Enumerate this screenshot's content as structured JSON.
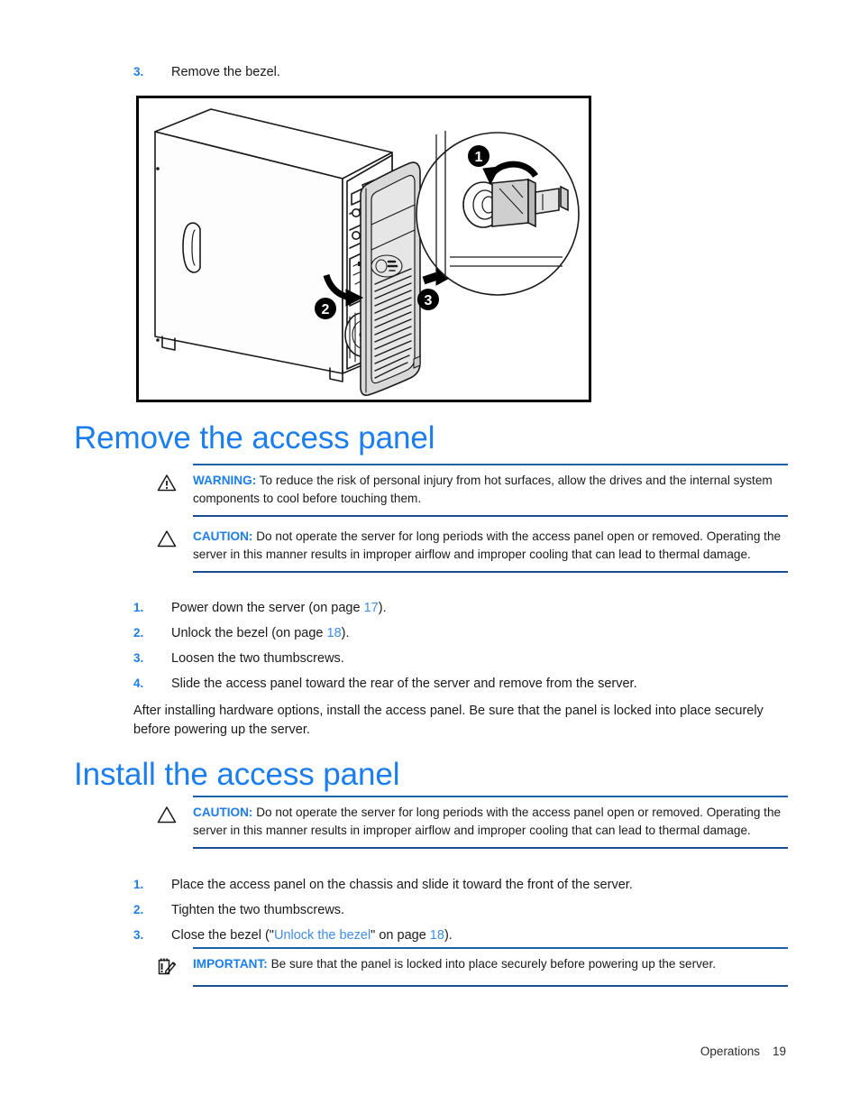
{
  "top_step": {
    "number": "3.",
    "text": "Remove the bezel."
  },
  "figure": {
    "alt": "Tower server with bezel removal steps",
    "callouts": [
      "1",
      "2",
      "3"
    ]
  },
  "sections": [
    {
      "heading": "Remove the access panel"
    },
    {
      "heading": "Install the access panel"
    }
  ],
  "notices": {
    "warning": {
      "icon": "warning-triangle-icon",
      "label": "WARNING:",
      "text": "To reduce the risk of personal injury from hot surfaces, allow the drives and the internal system components to cool before touching them."
    },
    "caution_remove": {
      "icon": "caution-triangle-icon",
      "label": "CAUTION:",
      "text": "Do not operate the server for long periods with the access panel open or removed. Operating the server in this manner results in improper airflow and improper cooling that can lead to thermal damage."
    },
    "caution_install": {
      "icon": "caution-triangle-icon",
      "label": "CAUTION:",
      "text": "Do not operate the server for long periods with the access panel open or removed. Operating the server in this manner results in improper airflow and improper cooling that can lead to thermal damage."
    },
    "important": {
      "icon": "notepad-pencil-icon",
      "label": "IMPORTANT:",
      "text": "Be sure that the panel is locked into place securely before powering up the server."
    }
  },
  "remove_steps": [
    {
      "number": "1.",
      "pre": "Power down the server (on page ",
      "link": "17",
      "post": ")."
    },
    {
      "number": "2.",
      "pre": "Unlock the bezel (on page ",
      "link": "18",
      "post": ")."
    },
    {
      "number": "3.",
      "pre": "Loosen the two thumbscrews.",
      "link": "",
      "post": ""
    },
    {
      "number": "4.",
      "pre": "Slide the access panel toward the rear of the server and remove from the server.",
      "link": "",
      "post": ""
    }
  ],
  "after_paragraph": "After installing hardware options, install the access panel. Be sure that the panel is locked into place securely before powering up the server.",
  "install_steps": [
    {
      "number": "1.",
      "pre": "Place the access panel on the chassis and slide it toward the front of the server.",
      "link": "",
      "post": ""
    },
    {
      "number": "2.",
      "pre": "Tighten the two thumbscrews.",
      "link": "",
      "post": ""
    },
    {
      "number": "3.",
      "pre": "Close the bezel (\"",
      "link": "Unlock the bezel",
      "post": "\" on page ",
      "link2": "18",
      "post2": ")."
    }
  ],
  "footer": {
    "chapter": "Operations",
    "page_number": "19"
  },
  "colors": {
    "heading_blue": "#1a7ef0",
    "link_blue": "#3b8ef0",
    "rule_navy": "#1b4d8e",
    "text": "#1a1a1a"
  }
}
